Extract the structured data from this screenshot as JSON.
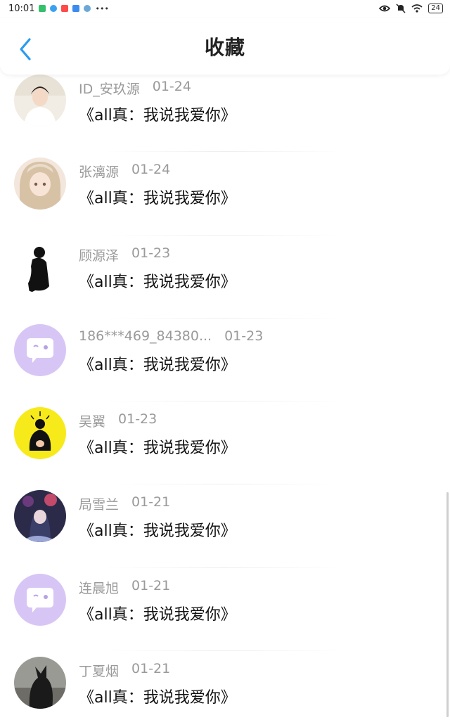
{
  "status_bar": {
    "time": "10:01",
    "battery": "24"
  },
  "header": {
    "title": "收藏"
  },
  "items": [
    {
      "user": "ID_安玖源",
      "date": "01-24",
      "content": "《all真：我说我爱你》",
      "avatar": "person-photo"
    },
    {
      "user": "张漓源",
      "date": "01-24",
      "content": "《all真：我说我爱你》",
      "avatar": "anime-girl"
    },
    {
      "user": "顾源泽",
      "date": "01-23",
      "content": "《all真：我说我爱你》",
      "avatar": "silhouette"
    },
    {
      "user": "186***469_84380...",
      "date": "01-23",
      "content": "《all真：我说我爱你》",
      "avatar": "default-chat"
    },
    {
      "user": "吴翼",
      "date": "01-23",
      "content": "《all真：我说我爱你》",
      "avatar": "bear-yellow"
    },
    {
      "user": "局雪兰",
      "date": "01-21",
      "content": "《all真：我说我爱你》",
      "avatar": "anime-night"
    },
    {
      "user": "连晨旭",
      "date": "01-21",
      "content": "《all真：我说我爱你》",
      "avatar": "default-chat"
    },
    {
      "user": "丁夏烟",
      "date": "01-21",
      "content": "《all真：我说我爱你》",
      "avatar": "dog-photo"
    }
  ],
  "colors": {
    "accent": "#2a9bf0",
    "default_avatar": "#d7c6f5",
    "meta_text": "#9a9a9a"
  }
}
